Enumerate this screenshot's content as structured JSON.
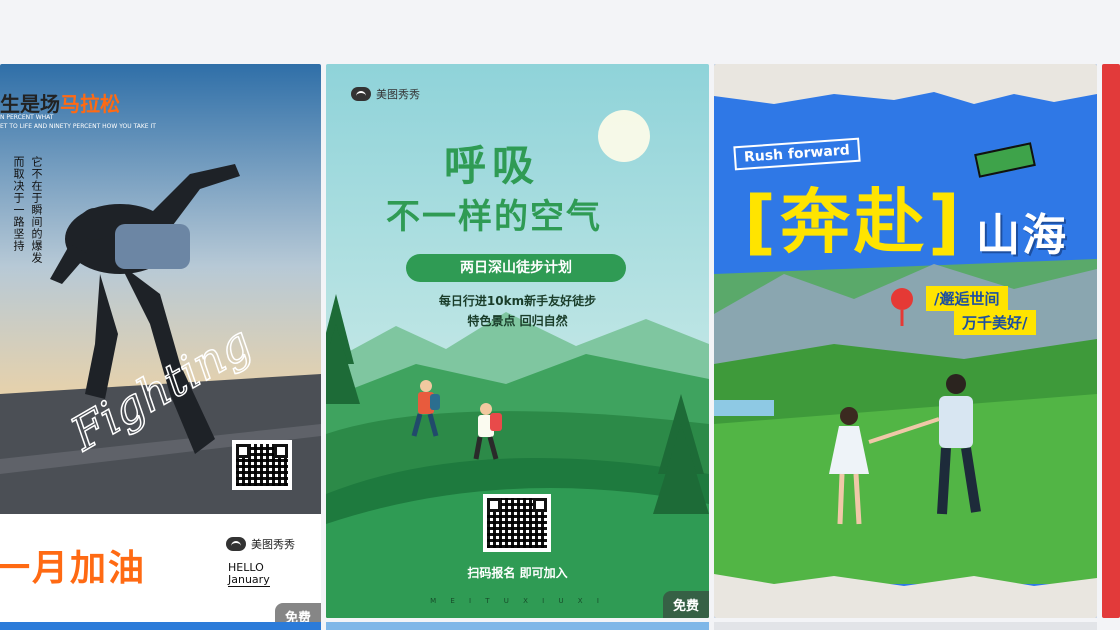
{
  "badge_label": "免费",
  "brand_name": "美图秀秀",
  "card1": {
    "title_prefix": "生是场",
    "title_highlight": "马拉松",
    "quote_line1": "N PERCENT WHAT",
    "quote_line2": "ET TO LIFE AND NINETY PERCENT HOW YOU TAKE IT",
    "vertical_1": "它不在于瞬间的爆发",
    "vertical_2": "而取决于一路坚持",
    "script_word": "Fighting",
    "bottom_title": "一月加油",
    "hello": "HELLO",
    "month": "January",
    "colors": {
      "accent": "#ff6a13"
    }
  },
  "card2": {
    "headline_1": "呼吸",
    "headline_2": "不一样的空气",
    "banner": "两日深山徒步计划",
    "line1": "每日行进10km新手友好徒步",
    "line2": "特色景点 回归自然",
    "cta": "扫码报名 即可加入",
    "footer_letters": "M E I T U X I U X I",
    "colors": {
      "green": "#2f9b54",
      "sky": "#bfe8df"
    }
  },
  "card3": {
    "rush": "Rush forward",
    "main_title": "奔赴",
    "sub_title": "山海",
    "tag1": "邂逅世间",
    "tag2": "万千美好",
    "colors": {
      "blue": "#2f78e6",
      "yellow": "#ffe400"
    }
  }
}
